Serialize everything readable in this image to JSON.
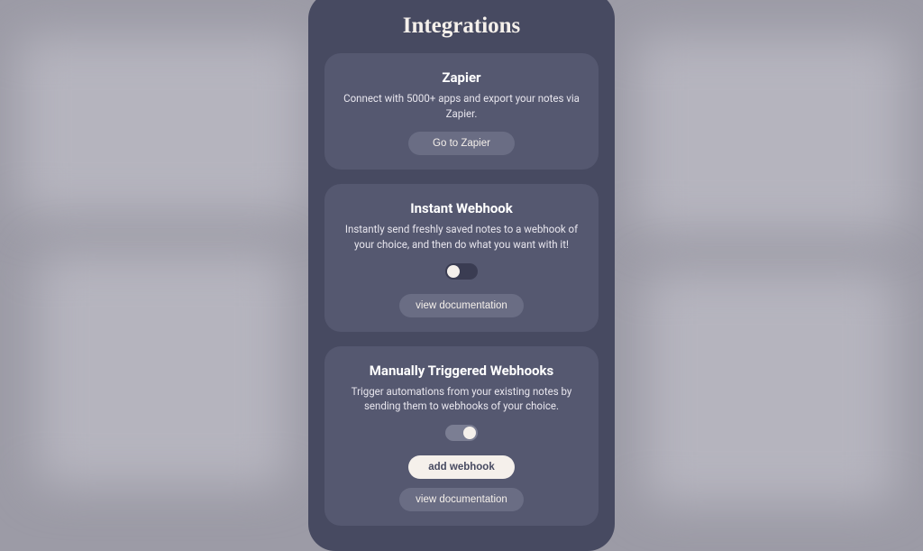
{
  "title": "Integrations",
  "zapier": {
    "title": "Zapier",
    "desc": "Connect with 5000+ apps and export your notes via Zapier.",
    "button": "Go to Zapier"
  },
  "instant": {
    "title": "Instant Webhook",
    "desc": "Instantly send freshly saved notes to a webhook of your choice, and then do what you want with it!",
    "toggle": false,
    "doc_button": "view documentation"
  },
  "manual": {
    "title": "Manually Triggered Webhooks",
    "desc": "Trigger automations from your existing notes by sending them to webhooks of your choice.",
    "toggle": true,
    "add_button": "add webhook",
    "doc_button": "view documentation"
  }
}
